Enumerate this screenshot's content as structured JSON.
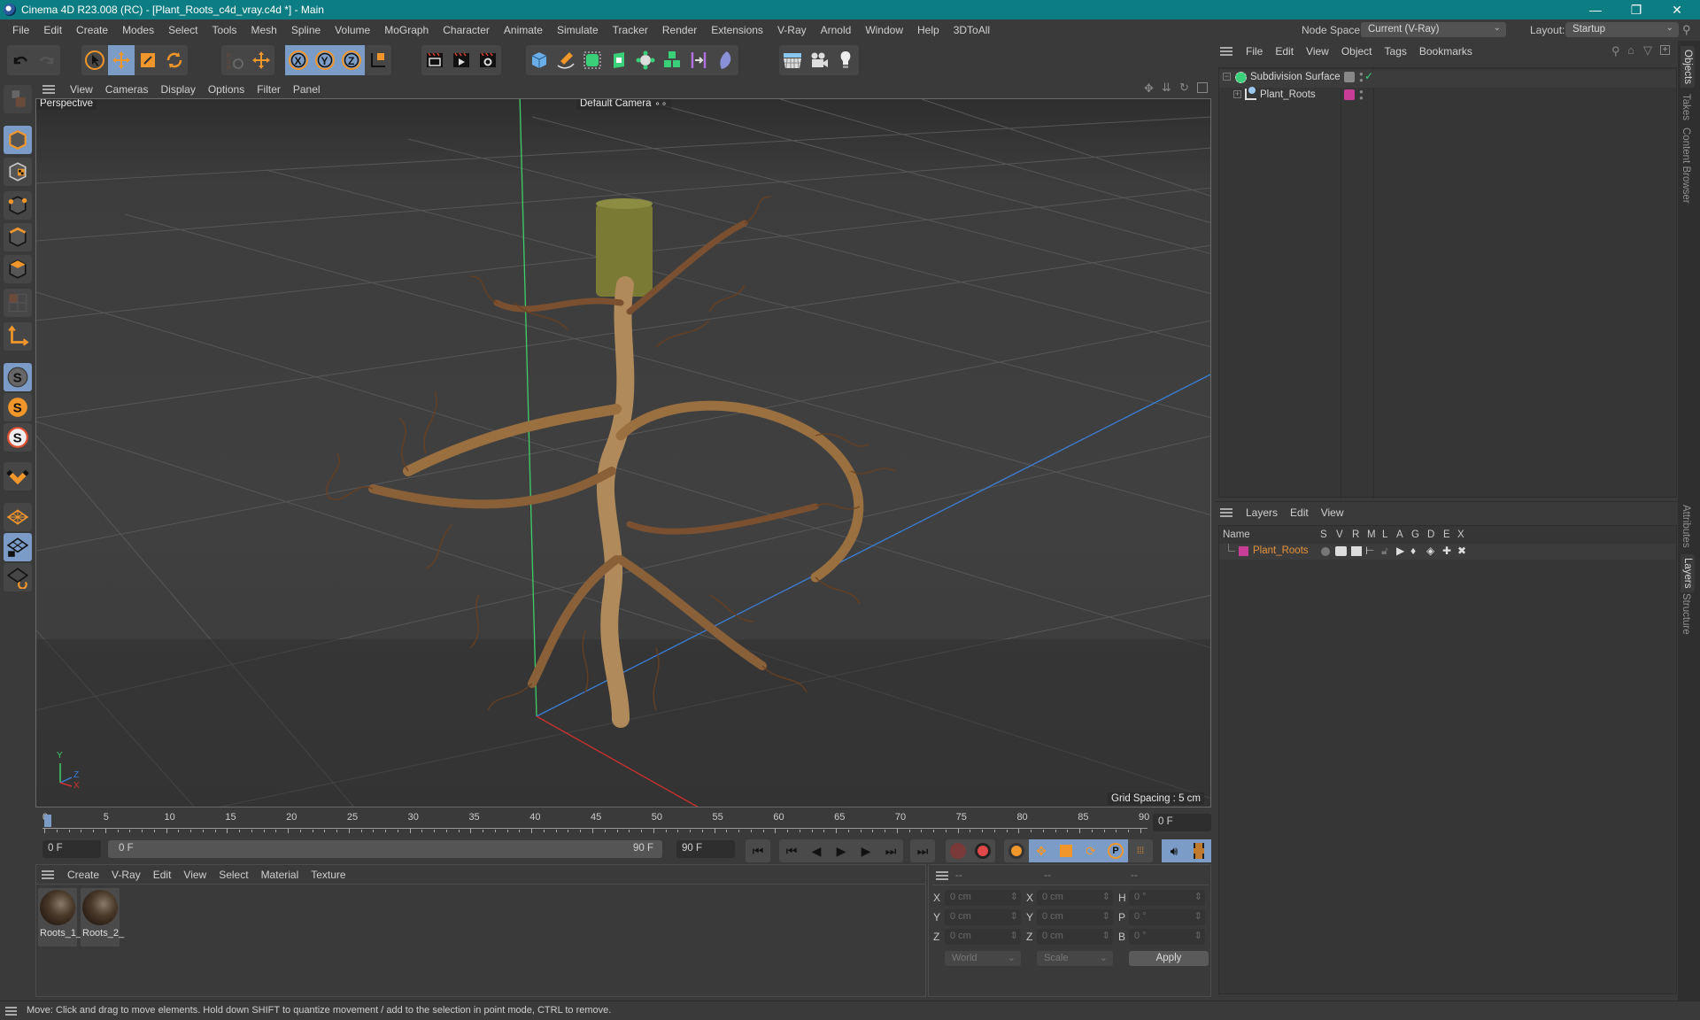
{
  "window": {
    "title": "Cinema 4D R23.008 (RC) - [Plant_Roots_c4d_vray.c4d *] - Main",
    "controls": {
      "minimize": "—",
      "maximize": "❐",
      "close": "✕"
    }
  },
  "menubar": {
    "items": [
      "File",
      "Edit",
      "Create",
      "Modes",
      "Select",
      "Tools",
      "Mesh",
      "Spline",
      "Volume",
      "MoGraph",
      "Character",
      "Animate",
      "Simulate",
      "Tracker",
      "Render",
      "Extensions",
      "V-Ray",
      "Arnold",
      "Window",
      "Help",
      "3DToAll"
    ]
  },
  "node_space": {
    "label": "Node Space:",
    "value": "Current (V-Ray)"
  },
  "layout": {
    "label": "Layout:",
    "value": "Startup"
  },
  "toolbar": {
    "groups": [
      [
        "undo-icon",
        "redo-icon"
      ],
      [
        "select-cursor-icon",
        "move-icon",
        "scale-icon",
        "rotate-icon"
      ],
      [
        "psr-icon",
        "move-axis-icon"
      ],
      [
        "x-axis-lock-icon",
        "y-axis-lock-icon",
        "z-axis-lock-icon",
        "coordinate-system-icon"
      ],
      [
        "render-view-icon",
        "render-picture-viewer-icon",
        "render-settings-icon"
      ],
      [
        "cube-icon",
        "pen-icon",
        "subdivision-icon",
        "extrude-icon",
        "mograph-cloner-icon",
        "array-icon",
        "symmetry-icon",
        "deformer-icon"
      ],
      [
        "floor-icon",
        "camera-icon",
        "light-icon"
      ]
    ]
  },
  "viewport": {
    "menu": [
      "View",
      "Cameras",
      "Display",
      "Options",
      "Filter",
      "Panel"
    ],
    "label": "Perspective",
    "camera": "Default Camera",
    "grid_spacing": "Grid Spacing : 5 cm",
    "axes": {
      "y": "Y",
      "z": "Z",
      "x": "X"
    },
    "colors": {
      "y_axis": "#3fcf6a",
      "x_axis": "#d03030",
      "z_axis": "#3a7fd8"
    }
  },
  "timeline": {
    "ticks": [
      "0",
      "5",
      "10",
      "15",
      "20",
      "25",
      "30",
      "35",
      "40",
      "45",
      "50",
      "55",
      "60",
      "65",
      "70",
      "75",
      "80",
      "85",
      "90"
    ],
    "current_frame": "0 F",
    "start_field": "0 F",
    "range_start": "0 F",
    "range_end": "90 F",
    "end_field": "90 F",
    "frame_display": "0 F"
  },
  "material_manager": {
    "menu": [
      "Create",
      "V-Ray",
      "Edit",
      "View",
      "Select",
      "Material",
      "Texture"
    ],
    "materials": [
      {
        "name": "Roots_1_"
      },
      {
        "name": "Roots_2_"
      }
    ]
  },
  "coordinates": {
    "headers": [
      "--",
      "--",
      "--"
    ],
    "rows": [
      {
        "l1": "X",
        "v1": "0 cm",
        "l2": "X",
        "v2": "0 cm",
        "l3": "H",
        "v3": "0 °"
      },
      {
        "l1": "Y",
        "v1": "0 cm",
        "l2": "Y",
        "v2": "0 cm",
        "l3": "P",
        "v3": "0 °"
      },
      {
        "l1": "Z",
        "v1": "0 cm",
        "l2": "Z",
        "v2": "0 cm",
        "l3": "B",
        "v3": "0 °"
      }
    ],
    "space": "World",
    "mode": "Scale",
    "apply": "Apply"
  },
  "object_manager": {
    "menu": [
      "File",
      "Edit",
      "View",
      "Object",
      "Tags",
      "Bookmarks"
    ],
    "objects": [
      {
        "name": "Subdivision Surface",
        "expanded": true
      },
      {
        "name": "Plant_Roots",
        "expanded": false,
        "layer_color": "#c83e96"
      }
    ]
  },
  "layer_manager": {
    "menu": [
      "Layers",
      "Edit",
      "View"
    ],
    "columns": [
      "Name",
      "S",
      "V",
      "R",
      "M",
      "L",
      "A",
      "G",
      "D",
      "E",
      "X"
    ],
    "layers": [
      {
        "name": "Plant_Roots",
        "color": "#c83e96",
        "text_color": "#e8923a"
      }
    ]
  },
  "right_tabs": {
    "top": [
      "Objects",
      "Takes",
      "Content Browser"
    ],
    "bottom": [
      "Attributes",
      "Layers",
      "Structure"
    ]
  },
  "status": "Move: Click and drag to move elements. Hold down SHIFT to quantize movement / add to the selection in point mode, CTRL to remove.",
  "colors": {
    "titlebar": "#0c7d83",
    "active_tool": "#7b9cc7",
    "accent_orange": "#f0962a"
  }
}
